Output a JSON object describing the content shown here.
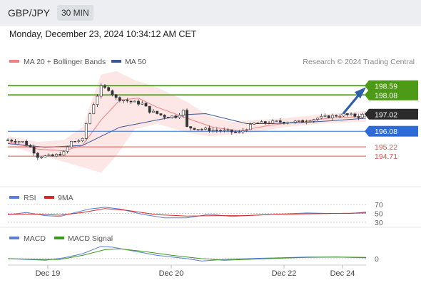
{
  "header": {
    "symbol": "GBP/JPY",
    "timeframe": "30 MIN"
  },
  "datetime": "Monday, December 23, 2024 10:34:12 AM CET",
  "credit": "Research © 2024 Trading Central",
  "colors": {
    "resistance": "#4c9a15",
    "support": "#d9534f",
    "pivot": "#2e6bd6",
    "price": "#2b2b2b",
    "ma20": "#f08080",
    "ma50": "#3b5998",
    "band": "#fde3e3",
    "rsi": "#5b7fd8",
    "rsi_ma": "#d62828",
    "macd": "#5b7fd8",
    "macd_signal": "#3a9a1a"
  },
  "chart_data": [
    {
      "type": "candlestick",
      "title": "GBP/JPY",
      "legend": [
        {
          "name": "MA 20 + Bollinger Bands",
          "color": "#f08080"
        },
        {
          "name": "MA 50",
          "color": "#3b5998"
        }
      ],
      "x_ticks": [
        "Dec 19",
        "Dec 20",
        "Dec 22",
        "Dec 24"
      ],
      "ylim": [
        193.3,
        199.7
      ],
      "levels": [
        {
          "value": 198.59,
          "label": "198.59",
          "kind": "resistance"
        },
        {
          "value": 198.08,
          "label": "198.08",
          "kind": "resistance"
        },
        {
          "value": 197.02,
          "label": "197.02",
          "kind": "last_price"
        },
        {
          "value": 196.08,
          "label": "196.08",
          "kind": "pivot"
        },
        {
          "value": 195.22,
          "label": "195.22",
          "kind": "support"
        },
        {
          "value": 194.71,
          "label": "194.71",
          "kind": "support"
        }
      ],
      "forecast_arrow": {
        "from": 197.05,
        "to": 198.59
      },
      "close_path": [
        [
          0,
          195.6
        ],
        [
          4,
          195.5
        ],
        [
          6,
          195.2
        ],
        [
          8,
          194.7
        ],
        [
          12,
          194.7
        ],
        [
          15,
          194.9
        ],
        [
          17,
          195.5
        ],
        [
          20,
          195.6
        ],
        [
          21,
          196.5
        ],
        [
          23,
          197.6
        ],
        [
          25,
          198.5
        ],
        [
          27,
          198.4
        ],
        [
          29,
          197.9
        ],
        [
          31,
          197.8
        ],
        [
          33,
          197.7
        ],
        [
          36,
          197.6
        ],
        [
          38,
          197.2
        ],
        [
          42,
          196.9
        ],
        [
          45,
          196.9
        ],
        [
          47,
          197.2
        ],
        [
          48,
          196.3
        ],
        [
          52,
          196.2
        ],
        [
          58,
          196.1
        ],
        [
          62,
          196.0
        ],
        [
          66,
          196.5
        ],
        [
          72,
          196.6
        ],
        [
          78,
          196.6
        ],
        [
          83,
          196.8
        ],
        [
          90,
          197.0
        ],
        [
          94,
          196.9
        ],
        [
          96,
          197.05
        ]
      ],
      "ma20": [
        [
          0,
          195.5
        ],
        [
          8,
          195.1
        ],
        [
          15,
          195.0
        ],
        [
          20,
          195.3
        ],
        [
          25,
          196.7
        ],
        [
          30,
          197.8
        ],
        [
          35,
          197.9
        ],
        [
          40,
          197.4
        ],
        [
          48,
          196.8
        ],
        [
          55,
          196.3
        ],
        [
          62,
          196.1
        ],
        [
          70,
          196.4
        ],
        [
          78,
          196.6
        ],
        [
          86,
          196.8
        ],
        [
          96,
          196.9
        ]
      ],
      "ma50": [
        [
          0,
          195.4
        ],
        [
          10,
          195.2
        ],
        [
          20,
          195.3
        ],
        [
          25,
          195.8
        ],
        [
          30,
          196.3
        ],
        [
          40,
          196.7
        ],
        [
          48,
          197.0
        ],
        [
          53,
          197.05
        ],
        [
          58,
          196.8
        ],
        [
          64,
          196.5
        ],
        [
          70,
          196.5
        ],
        [
          78,
          196.55
        ],
        [
          86,
          196.65
        ],
        [
          96,
          196.8
        ]
      ],
      "bb_upper": [
        [
          0,
          195.8
        ],
        [
          8,
          195.5
        ],
        [
          15,
          195.6
        ],
        [
          20,
          196.3
        ],
        [
          25,
          199.2
        ],
        [
          29,
          199.4
        ],
        [
          34,
          198.9
        ],
        [
          40,
          198.5
        ],
        [
          48,
          197.7
        ],
        [
          54,
          196.9
        ],
        [
          60,
          196.6
        ],
        [
          66,
          196.7
        ],
        [
          74,
          196.8
        ],
        [
          84,
          197.0
        ],
        [
          96,
          197.2
        ]
      ],
      "bb_lower": [
        [
          0,
          195.3
        ],
        [
          8,
          194.8
        ],
        [
          15,
          194.4
        ],
        [
          20,
          194.1
        ],
        [
          25,
          193.8
        ],
        [
          29,
          194.7
        ],
        [
          34,
          196.2
        ],
        [
          40,
          196.5
        ],
        [
          48,
          196.0
        ],
        [
          54,
          195.8
        ],
        [
          60,
          195.9
        ],
        [
          66,
          196.0
        ],
        [
          74,
          196.3
        ],
        [
          84,
          196.5
        ],
        [
          96,
          196.6
        ]
      ]
    },
    {
      "type": "line",
      "legend": [
        {
          "name": "RSI",
          "color": "#5b7fd8"
        },
        {
          "name": "9MA",
          "color": "#d62828"
        }
      ],
      "ylim": [
        20,
        80
      ],
      "y_ticks": [
        70,
        50,
        30
      ],
      "rsi": [
        [
          0,
          47
        ],
        [
          5,
          52
        ],
        [
          10,
          45
        ],
        [
          14,
          43
        ],
        [
          18,
          52
        ],
        [
          22,
          60
        ],
        [
          26,
          64
        ],
        [
          30,
          60
        ],
        [
          36,
          48
        ],
        [
          42,
          40
        ],
        [
          48,
          40
        ],
        [
          54,
          48
        ],
        [
          60,
          43
        ],
        [
          66,
          46
        ],
        [
          72,
          48
        ],
        [
          80,
          51
        ],
        [
          86,
          50
        ],
        [
          92,
          50
        ],
        [
          96,
          53
        ]
      ],
      "rsi_ma": [
        [
          0,
          48
        ],
        [
          8,
          48
        ],
        [
          14,
          46
        ],
        [
          20,
          52
        ],
        [
          26,
          61
        ],
        [
          32,
          57
        ],
        [
          40,
          47
        ],
        [
          48,
          44
        ],
        [
          56,
          45
        ],
        [
          64,
          45
        ],
        [
          72,
          48
        ],
        [
          80,
          49
        ],
        [
          88,
          50
        ],
        [
          96,
          51
        ]
      ]
    },
    {
      "type": "line",
      "legend": [
        {
          "name": "MACD",
          "color": "#5b7fd8"
        },
        {
          "name": "MACD Signal",
          "color": "#3a9a1a"
        }
      ],
      "ylim": [
        -1,
        1
      ],
      "y_ticks": [
        0
      ],
      "macd": [
        [
          0,
          0.0
        ],
        [
          5,
          -0.05
        ],
        [
          10,
          -0.1
        ],
        [
          15,
          0.05
        ],
        [
          20,
          0.3
        ],
        [
          25,
          0.75
        ],
        [
          28,
          0.7
        ],
        [
          34,
          0.45
        ],
        [
          40,
          0.2
        ],
        [
          48,
          0.0
        ],
        [
          52,
          -0.15
        ],
        [
          58,
          -0.05
        ],
        [
          64,
          0.0
        ],
        [
          72,
          0.05
        ],
        [
          80,
          0.1
        ],
        [
          88,
          0.1
        ],
        [
          96,
          0.05
        ]
      ],
      "macd_signal": [
        [
          0,
          0.0
        ],
        [
          8,
          -0.05
        ],
        [
          14,
          -0.05
        ],
        [
          20,
          0.2
        ],
        [
          26,
          0.55
        ],
        [
          30,
          0.6
        ],
        [
          36,
          0.45
        ],
        [
          44,
          0.2
        ],
        [
          52,
          0.0
        ],
        [
          58,
          -0.1
        ],
        [
          64,
          -0.05
        ],
        [
          72,
          0.02
        ],
        [
          80,
          0.08
        ],
        [
          88,
          0.1
        ],
        [
          96,
          0.08
        ]
      ]
    }
  ]
}
